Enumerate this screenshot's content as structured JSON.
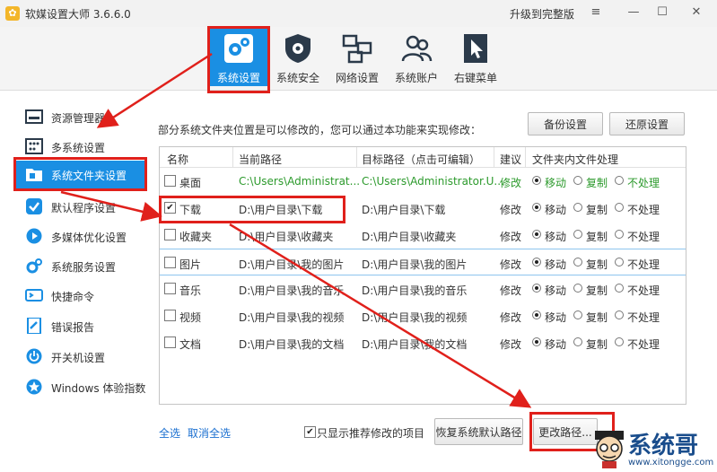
{
  "app": {
    "title": "软媒设置大师 3.6.6.0",
    "logo_glyph": "✿",
    "upgrade": "升级到完整版"
  },
  "window": {
    "menu": "≡",
    "minimize": "—",
    "maximize": "☐",
    "close": "✕"
  },
  "toolbar": [
    {
      "label": "系统设置",
      "icon": "gears-icon"
    },
    {
      "label": "系统安全",
      "icon": "shield-icon"
    },
    {
      "label": "网络设置",
      "icon": "network-icon"
    },
    {
      "label": "系统账户",
      "icon": "users-icon"
    },
    {
      "label": "右键菜单",
      "icon": "cursor-icon"
    }
  ],
  "sidebar": [
    {
      "label": "资源管理器",
      "icon": "explorer-icon"
    },
    {
      "label": "多系统设置",
      "icon": "multi-system-icon"
    },
    {
      "label": "系统文件夹设置",
      "icon": "folder-icon"
    },
    {
      "label": "默认程序设置",
      "icon": "check-icon"
    },
    {
      "label": "多媒体优化设置",
      "icon": "media-icon"
    },
    {
      "label": "系统服务设置",
      "icon": "service-icon"
    },
    {
      "label": "快捷命令",
      "icon": "command-icon"
    },
    {
      "label": "错误报告",
      "icon": "report-icon"
    },
    {
      "label": "开关机设置",
      "icon": "power-icon"
    },
    {
      "label": "Windows 体验指数",
      "icon": "star-icon"
    }
  ],
  "main": {
    "description": "部分系统文件夹位置是可以修改的，您可以通过本功能来实现修改：",
    "backup": "备份设置",
    "restore": "还原设置",
    "columns": [
      "名称",
      "当前路径",
      "目标路径（点击可编辑）",
      "建议",
      "文件夹内文件处理"
    ],
    "options": [
      "移动",
      "复制",
      "不处理"
    ],
    "rows": [
      {
        "name": "桌面",
        "current": "C:\\Users\\Administrat...",
        "target": "C:\\Users\\Administrator.U...",
        "suggest": "修改",
        "checked": "",
        "green": true
      },
      {
        "name": "下载",
        "current": "D:\\用户目录\\下载",
        "target": "D:\\用户目录\\下载",
        "suggest": "修改",
        "checked": "✔",
        "green": false
      },
      {
        "name": "收藏夹",
        "current": "D:\\用户目录\\收藏夹",
        "target": "D:\\用户目录\\收藏夹",
        "suggest": "修改",
        "checked": "",
        "green": false
      },
      {
        "name": "图片",
        "current": "D:\\用户目录\\我的图片",
        "target": "D:\\用户目录\\我的图片",
        "suggest": "修改",
        "checked": "",
        "green": false
      },
      {
        "name": "音乐",
        "current": "D:\\用户目录\\我的音乐",
        "target": "D:\\用户目录\\我的音乐",
        "suggest": "修改",
        "checked": "",
        "green": false
      },
      {
        "name": "视频",
        "current": "D:\\用户目录\\我的视频",
        "target": "D:\\用户目录\\我的视频",
        "suggest": "修改",
        "checked": "",
        "green": false
      },
      {
        "name": "文档",
        "current": "D:\\用户目录\\我的文档",
        "target": "D:\\用户目录\\我的文档",
        "suggest": "修改",
        "checked": "",
        "green": false
      }
    ],
    "select_all": "全选",
    "deselect_all": "取消全选",
    "show_recommended_check": "✔",
    "show_recommended": "只显示推荐修改的项目",
    "restore_default": "恢复系统默认路径",
    "change_path": "更改路径..."
  },
  "watermark": {
    "text": "系统哥",
    "url": "www.xitongge.com"
  },
  "colors": {
    "accent": "#1a8fe3",
    "highlight": "#e0201b",
    "green": "#2c9a2c"
  }
}
